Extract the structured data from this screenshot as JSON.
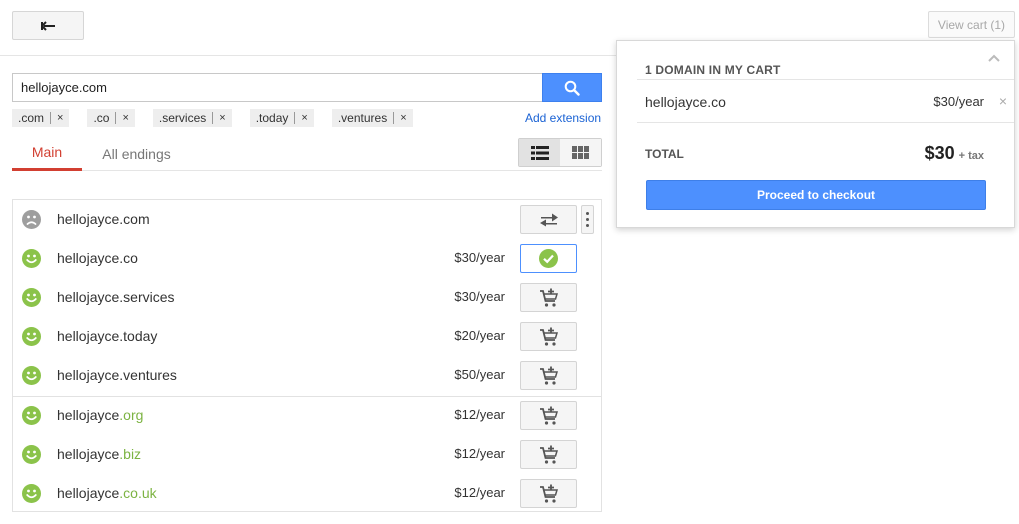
{
  "header": {
    "view_cart_label": "View cart (1)"
  },
  "search": {
    "value": "hellojayce.com"
  },
  "extensions": [
    {
      "label": ".com"
    },
    {
      "label": ".co"
    },
    {
      "label": ".services"
    },
    {
      "label": ".today"
    },
    {
      "label": ".ventures"
    }
  ],
  "add_extension_label": "Add extension",
  "chip_remove_glyph": "×",
  "tabs": [
    {
      "label": "Main",
      "active": true
    },
    {
      "label": "All endings",
      "active": false
    }
  ],
  "results": [
    {
      "name": "hellojayce",
      "tld": ".com",
      "tld_highlight": false,
      "price": "",
      "status": "unavailable",
      "action": "transfer"
    },
    {
      "name": "hellojayce",
      "tld": ".co",
      "tld_highlight": false,
      "price": "$30/year",
      "status": "available",
      "action": "in-cart"
    },
    {
      "name": "hellojayce",
      "tld": ".services",
      "tld_highlight": false,
      "price": "$30/year",
      "status": "available",
      "action": "add-to-cart"
    },
    {
      "name": "hellojayce",
      "tld": ".today",
      "tld_highlight": false,
      "price": "$20/year",
      "status": "available",
      "action": "add-to-cart"
    },
    {
      "name": "hellojayce",
      "tld": ".ventures",
      "tld_highlight": false,
      "price": "$50/year",
      "status": "available",
      "action": "add-to-cart"
    },
    {
      "name": "hellojayce",
      "tld": ".org",
      "tld_highlight": true,
      "price": "$12/year",
      "status": "available",
      "action": "add-to-cart"
    },
    {
      "name": "hellojayce",
      "tld": ".biz",
      "tld_highlight": true,
      "price": "$12/year",
      "status": "available",
      "action": "add-to-cart"
    },
    {
      "name": "hellojayce",
      "tld": ".co.uk",
      "tld_highlight": true,
      "price": "$12/year",
      "status": "available",
      "action": "add-to-cart"
    }
  ],
  "cart": {
    "heading": "1 DOMAIN IN MY CART",
    "item_name": "hellojayce.co",
    "item_price": "$30/year",
    "remove_glyph": "×",
    "total_label": "TOTAL",
    "total_amount": "$30",
    "total_suffix": "+ tax",
    "checkout_label": "Proceed to checkout"
  },
  "colors": {
    "accent_blue": "#4d90fe",
    "tab_active_red": "#d23f31",
    "available_green": "#8bc34a",
    "unavailable_gray": "#9e9e9e"
  }
}
